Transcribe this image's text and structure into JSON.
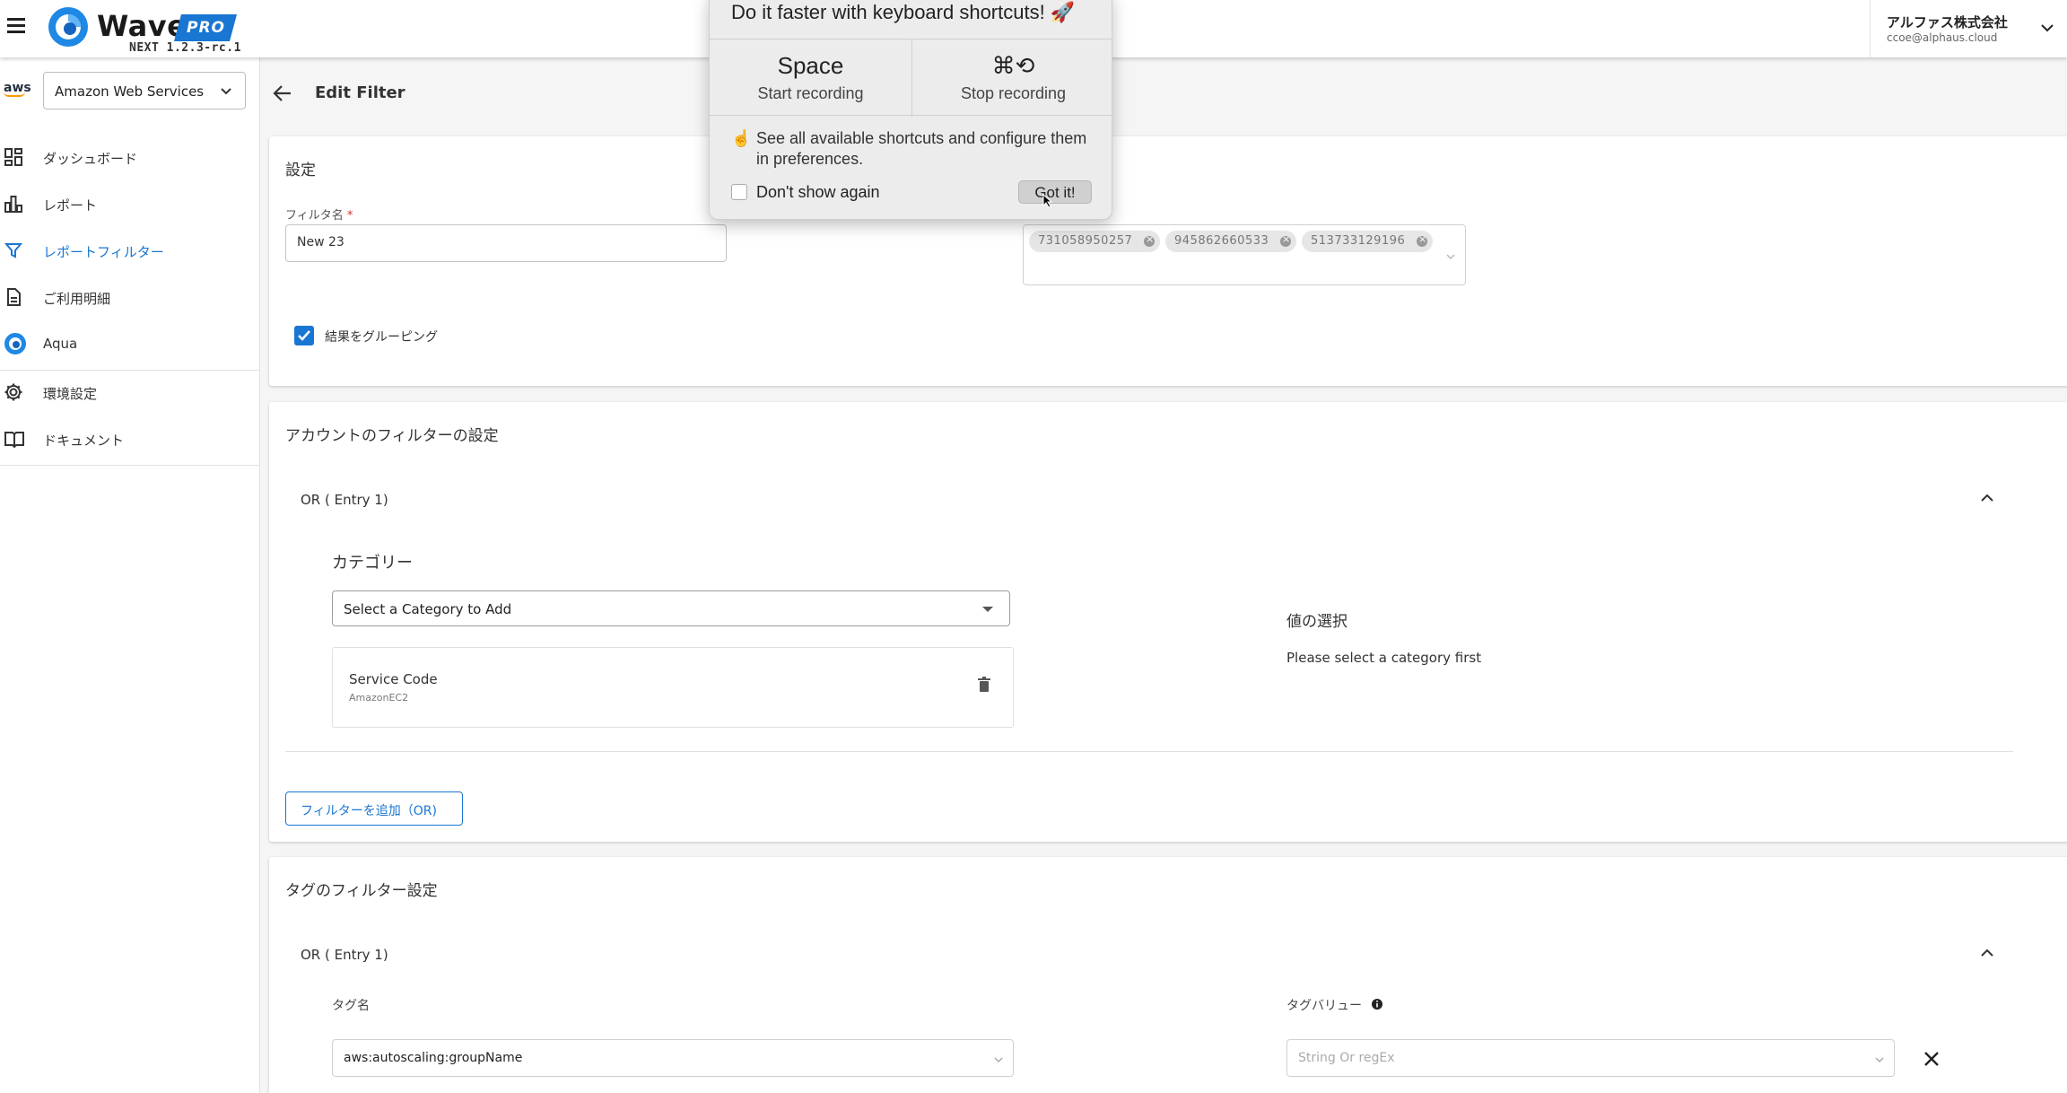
{
  "header": {
    "brand": "Wave",
    "tier": "PRO",
    "version": "NEXT 1.2.3-rc.1",
    "company": "アルファス株式会社",
    "email": "ccoe@alphaus.cloud"
  },
  "sidebar": {
    "provider_logo_text": "aws",
    "provider_select": "Amazon Web Services",
    "items": [
      {
        "label": "ダッシュボード",
        "icon": "dashboard-icon"
      },
      {
        "label": "レポート",
        "icon": "bar-chart-icon"
      },
      {
        "label": "レポートフィルター",
        "icon": "filter-icon",
        "active": true
      },
      {
        "label": "ご利用明細",
        "icon": "document-icon"
      },
      {
        "label": "Aqua",
        "icon": "aqua-logo-icon"
      },
      {
        "label": "環境設定",
        "icon": "gear-icon"
      },
      {
        "label": "ドキュメント",
        "icon": "book-icon"
      }
    ]
  },
  "main": {
    "title": "Edit Filter",
    "settings": {
      "title": "設定",
      "filter_name_label": "フィルタ名",
      "required_mark": "*",
      "filter_name_value": "New 23",
      "accounts": [
        "731058950257",
        "945862660533",
        "513733129196"
      ],
      "group_results_label": "結果をグルーピング",
      "group_results_checked": true
    },
    "account_filter": {
      "title": "アカウントのフィルターの設定",
      "entry_label": "OR ( Entry 1)",
      "category_heading": "カテゴリー",
      "category_placeholder": "Select a Category to Add",
      "service_code_title": "Service Code",
      "service_code_value": "AmazonEC2",
      "value_heading": "値の選択",
      "value_hint": "Please select a category first",
      "add_filter_label": "フィルターを追加（OR)"
    },
    "tag_filter": {
      "title": "タグのフィルター設定",
      "entry_label": "OR ( Entry 1)",
      "tag_name_label": "タグ名",
      "tag_name_value": "aws:autoscaling:groupName",
      "tag_value_label": "タグバリュー",
      "tag_value_placeholder": "String Or regEx"
    }
  },
  "popup": {
    "title": "Do it faster with keyboard shortcuts! 🚀",
    "start_key": "Space",
    "start_action": "Start recording",
    "stop_key": "⌘⟲",
    "stop_action": "Stop recording",
    "tip_icon": "☝",
    "tip": "See all available shortcuts and configure them in preferences.",
    "dont_show_label": "Don't show again",
    "got_it_label": "Got it!"
  },
  "colors": {
    "accent": "#1976d2",
    "aws_orange": "#ff9900"
  }
}
